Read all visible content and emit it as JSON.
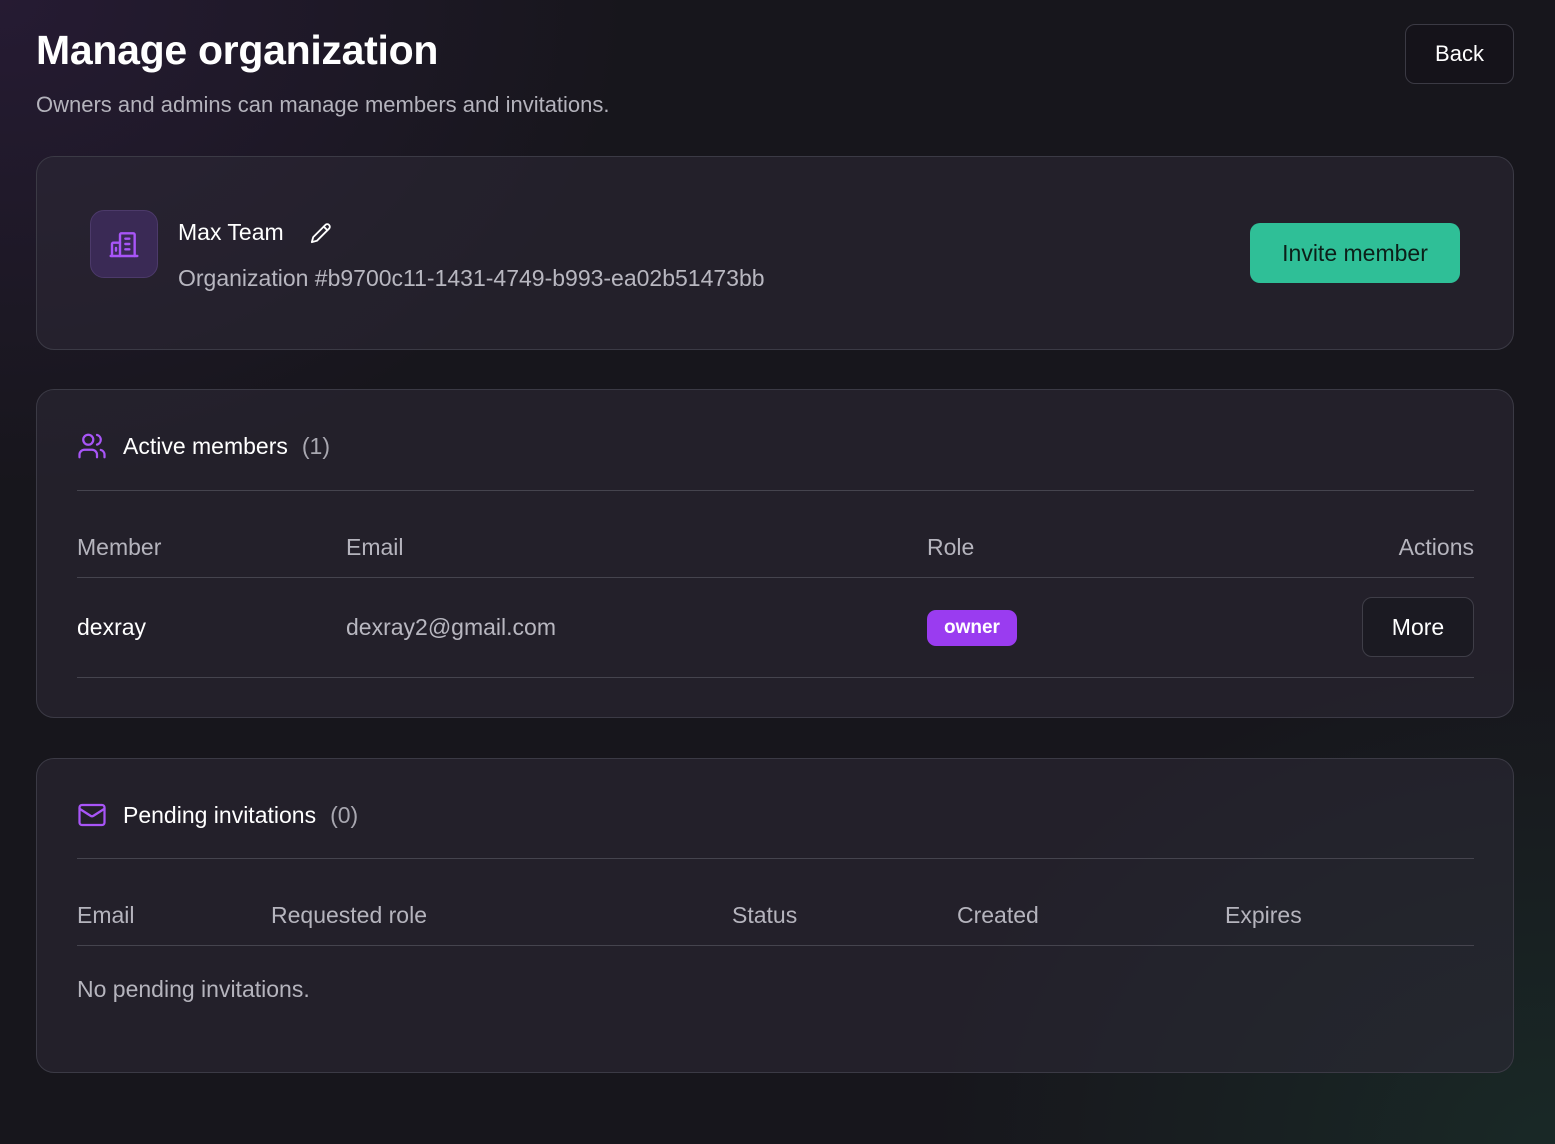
{
  "header": {
    "title": "Manage organization",
    "subtitle": "Owners and admins can manage members and invitations.",
    "back_label": "Back"
  },
  "organization": {
    "name": "Max Team",
    "id_text": "Organization #b9700c11-1431-4749-b993-ea02b51473bb",
    "invite_label": "Invite member",
    "icon": "building-icon",
    "edit_icon": "pencil-icon"
  },
  "members": {
    "title": "Active members",
    "count": "(1)",
    "icon": "users-icon",
    "columns": {
      "member": "Member",
      "email": "Email",
      "role": "Role",
      "actions": "Actions"
    },
    "rows": [
      {
        "member": "dexray",
        "email": "dexray2@gmail.com",
        "role": "owner",
        "action_label": "More"
      }
    ]
  },
  "invitations": {
    "title": "Pending invitations",
    "count": "(0)",
    "icon": "mail-icon",
    "columns": {
      "email": "Email",
      "requested_role": "Requested role",
      "status": "Status",
      "created": "Created",
      "expires": "Expires"
    },
    "empty_text": "No pending invitations."
  },
  "colors": {
    "accent_purple": "#a855f7",
    "badge_purple": "#9a3cf0",
    "invite_green": "#2fbf97"
  }
}
